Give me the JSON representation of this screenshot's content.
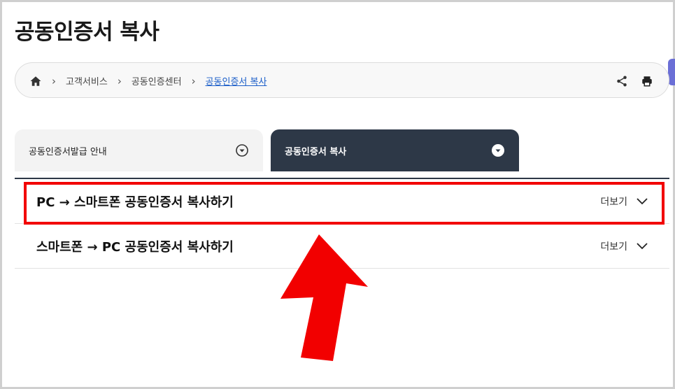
{
  "page": {
    "title": "공동인증서 복사"
  },
  "breadcrumb": {
    "home_icon": "home-icon",
    "items": [
      "고객서비스",
      "공동인증센터",
      "공동인증서 복사"
    ],
    "separator": ">"
  },
  "actions": {
    "share_icon": "share-icon",
    "print_icon": "print-icon"
  },
  "tabs": [
    {
      "label": "공동인증서발급 안내",
      "active": false
    },
    {
      "label": "공동인증서 복사",
      "active": true
    }
  ],
  "accordion": [
    {
      "title": "PC → 스마트폰 공동인증서 복사하기",
      "more_label": "더보기",
      "highlighted": true
    },
    {
      "title": "스마트폰 → PC 공동인증서 복사하기",
      "more_label": "더보기",
      "highlighted": false
    }
  ],
  "colors": {
    "active_tab": "#2d3847",
    "highlight": "#f20000",
    "link": "#1b5ec9"
  }
}
